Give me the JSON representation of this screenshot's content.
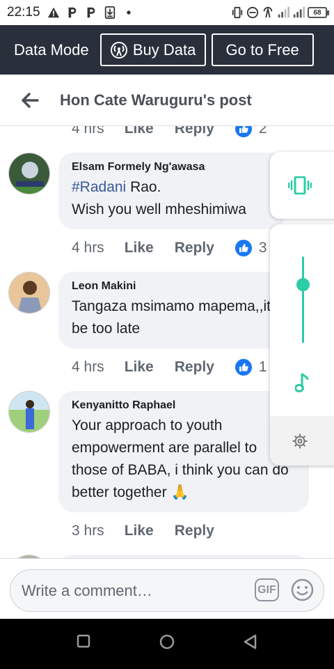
{
  "status_bar": {
    "time": "22:15",
    "battery": "68",
    "icons": [
      "warning-icon",
      "p-notification-icon",
      "p-notification-icon",
      "download-icon",
      "dot-icon",
      "vibrate-icon",
      "dnd-icon",
      "hotspot-icon",
      "signal-icon",
      "signal-icon",
      "battery-icon"
    ]
  },
  "data_bar": {
    "mode_label": "Data Mode",
    "buy_label": "Buy Data",
    "free_label": "Go to Free"
  },
  "header": {
    "title": "Hon Cate Waruguru's post"
  },
  "comments": [
    {
      "author": "",
      "text": "",
      "time": "4 hrs",
      "like_label": "Like",
      "reply_label": "Reply",
      "reactions": "2"
    },
    {
      "author": "Elsam Formely Ng'awasa",
      "hashtag": "#Radani",
      "text_after_hashtag": " Rao.",
      "text_line2": "Wish you well mheshimiwa",
      "time": "4 hrs",
      "like_label": "Like",
      "reply_label": "Reply",
      "reactions": "3"
    },
    {
      "author": "Leon Makini",
      "text": "Tangaza msimamo mapema,,it will be too late",
      "time": "4 hrs",
      "like_label": "Like",
      "reply_label": "Reply",
      "reactions": "1"
    },
    {
      "author": "Kenyanitto Raphael",
      "text": "Your approach to youth empowerment are parallel to those of BABA, i think you can do better together",
      "emoji": "🙏",
      "time": "3 hrs",
      "like_label": "Like",
      "reply_label": "Reply"
    }
  ],
  "composer": {
    "placeholder": "Write a comment…",
    "gif_label": "GIF"
  },
  "sound_panel": {
    "accent": "#2bcca6",
    "volume_level_percent": 75
  },
  "colors": {
    "data_bar_bg": "#2a2f3c",
    "like_blue": "#1877f2",
    "bubble_bg": "#f0f2f5",
    "hashtag": "#385898"
  }
}
